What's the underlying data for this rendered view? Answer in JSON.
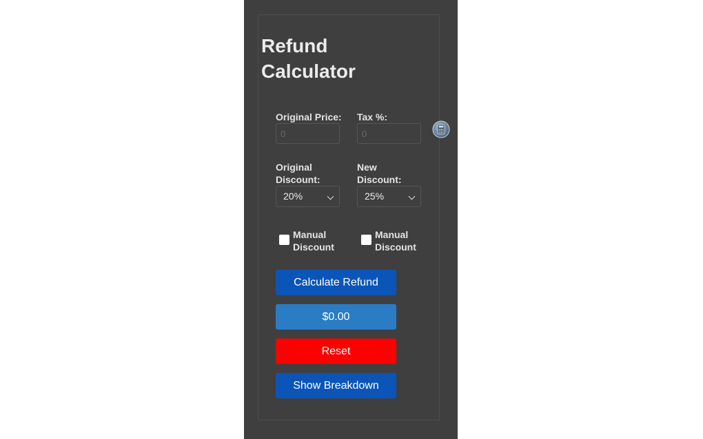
{
  "title": "Refund Calculator",
  "fields": {
    "original_price": {
      "label": "Original Price:",
      "placeholder": "0"
    },
    "tax": {
      "label": "Tax %:",
      "placeholder": "0"
    }
  },
  "discounts": {
    "original": {
      "label": "Original Discount:",
      "selected": "20%"
    },
    "new": {
      "label": "New Discount:",
      "selected": "25%"
    }
  },
  "manual": {
    "left_label": "Manual Discount",
    "right_label": "Manual Discount"
  },
  "buttons": {
    "calculate": "Calculate Refund",
    "result": "$0.00",
    "reset": "Reset",
    "breakdown": "Show Breakdown"
  },
  "colors": {
    "panel_bg": "#3f3f3f",
    "primary_blue": "#0b55b9",
    "result_blue": "#2a7cc4",
    "reset_red": "#ff0000"
  },
  "icons": {
    "calculator": "calculator-icon"
  }
}
